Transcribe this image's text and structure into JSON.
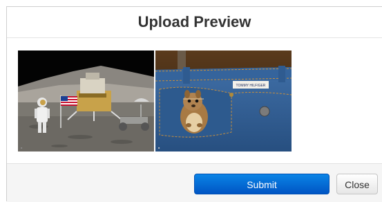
{
  "modal": {
    "title": "Upload Preview",
    "images": [
      {
        "name": "moon-landing-image",
        "description": "astronaut"
      },
      {
        "name": "squirrel-jeans-image",
        "label_text": "TOMMY HILFIGER"
      }
    ]
  },
  "footer": {
    "submit_label": "Submit",
    "close_label": "Close"
  },
  "colors": {
    "primary": "#0a6fdc",
    "background": "#ffffff",
    "footer_bg": "#f5f5f5"
  }
}
